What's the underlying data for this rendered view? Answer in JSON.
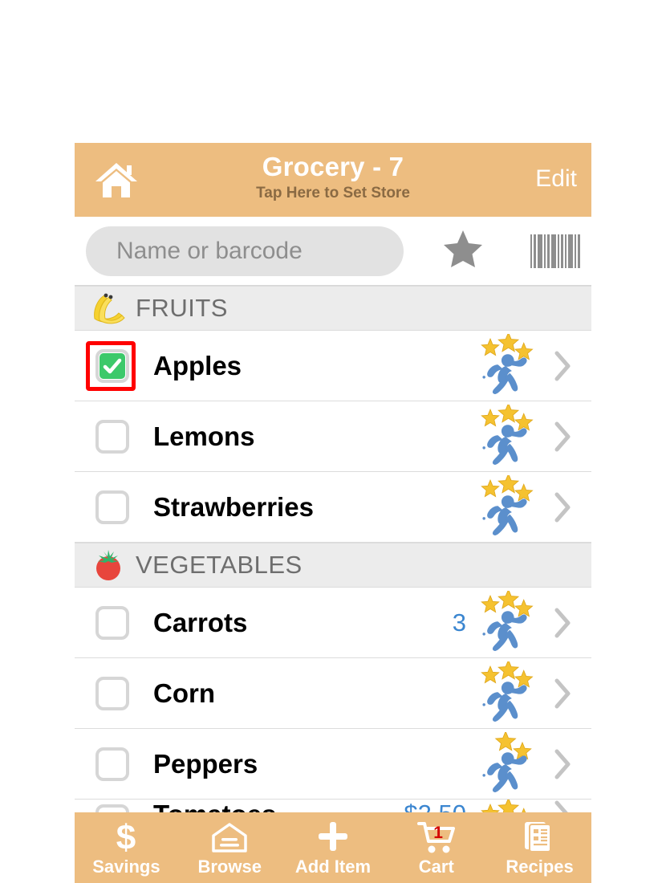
{
  "header": {
    "home_icon": "home-icon",
    "title": "Grocery - 7",
    "subtitle": "Tap Here to Set Store",
    "edit_label": "Edit",
    "bg_color": "#edbd80",
    "title_color": "#ffffff",
    "subtitle_color": "#8a6a43"
  },
  "search": {
    "placeholder": "Name or barcode",
    "value": "",
    "favorite_icon": "star-icon",
    "barcode_icon": "barcode-icon"
  },
  "sections": [
    {
      "emoji": "🍌",
      "emoji_name": "banana-icon",
      "label": "FRUITS",
      "items": [
        {
          "name": "Apples",
          "checked": true,
          "stars": 3,
          "qty": "",
          "chevron": "chevron-right-icon"
        },
        {
          "name": "Lemons",
          "checked": false,
          "stars": 3,
          "qty": "",
          "chevron": "chevron-right-icon"
        },
        {
          "name": "Strawberries",
          "checked": false,
          "stars": 3,
          "qty": "",
          "chevron": "chevron-right-icon"
        }
      ]
    },
    {
      "emoji": "🍅",
      "emoji_name": "tomato-icon",
      "label": "VEGETABLES",
      "items": [
        {
          "name": "Carrots",
          "checked": false,
          "stars": 3,
          "qty": "3",
          "chevron": "chevron-right-icon"
        },
        {
          "name": "Corn",
          "checked": false,
          "stars": 3,
          "qty": "",
          "chevron": "chevron-right-icon"
        },
        {
          "name": "Peppers",
          "checked": false,
          "stars": 2,
          "qty": "",
          "chevron": "chevron-right-icon"
        }
      ]
    }
  ],
  "highlight": {
    "target": "apples-checkbox",
    "color": "#ff0000"
  },
  "colors": {
    "accent": "#edbd80",
    "checked_green": "#3cc96a",
    "runner_blue": "#5b8fcc",
    "star_gold": "#f5c230",
    "qty_blue": "#3b86d0",
    "section_bg": "#ececec",
    "badge_red": "#d40000"
  },
  "tabbar": {
    "items": [
      {
        "icon": "dollar-icon",
        "label": "Savings",
        "badge": ""
      },
      {
        "icon": "browse-icon",
        "label": "Browse",
        "badge": ""
      },
      {
        "icon": "plus-icon",
        "label": "Add Item",
        "badge": ""
      },
      {
        "icon": "cart-icon",
        "label": "Cart",
        "badge": "1"
      },
      {
        "icon": "recipes-icon",
        "label": "Recipes",
        "badge": ""
      }
    ]
  }
}
